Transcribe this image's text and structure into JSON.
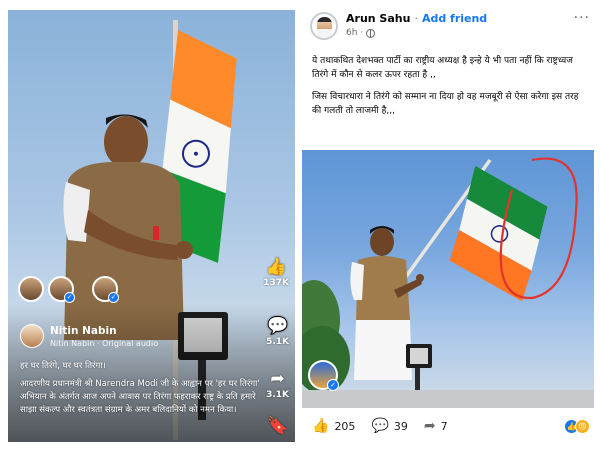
{
  "reel": {
    "likes": "137K",
    "comments": "5.1K",
    "shares": "3.1K",
    "author_name": "Nitin Nabin",
    "audio_label": "Nitin Nabin · Original audio",
    "caption_line1": "हर घर तिरंगे, घर घर तिरंगा।",
    "caption_line2": "आदरणीय प्रधानमंत्री श्री Narendra Modi जी के आह्वान पर 'हर घर तिरंगा' अभियान के अंतर्गत आज अपने आवास पर तिरंगा फहराकर राष्ट्र के प्रति हमारे साझा संकल्प और स्वतंत्रता संग्राम के अमर बलिदानियों को नमन किया।",
    "icons": [
      "like-icon",
      "comment-icon",
      "share-icon",
      "save-icon",
      "verified-icon"
    ]
  },
  "post": {
    "name": "Arun Sahu",
    "separator": "·",
    "add_friend": "Add friend",
    "time": "6h ·",
    "more": "···",
    "para1": "ये तथाकथित देशभक्त पार्टी का राष्ट्रीय अध्यक्ष है इन्हे ये भी पता नहीं कि राष्ट्रध्वज तिरंगे में कौन से कलर ऊपर रहता है ,,",
    "para2": "जिस विचारधारा ने तिरंगे को सम्मान ना दिया हो वह मजबूरी से ऐसा करेगा इस तरह की गलती तो लाजमी है,,,",
    "likes": "205",
    "comments": "39",
    "shares": "7",
    "colors": {
      "brand": "#1877f2",
      "saffron": "#ff7722",
      "green": "#138808",
      "red_circle": "#e5322d"
    }
  }
}
